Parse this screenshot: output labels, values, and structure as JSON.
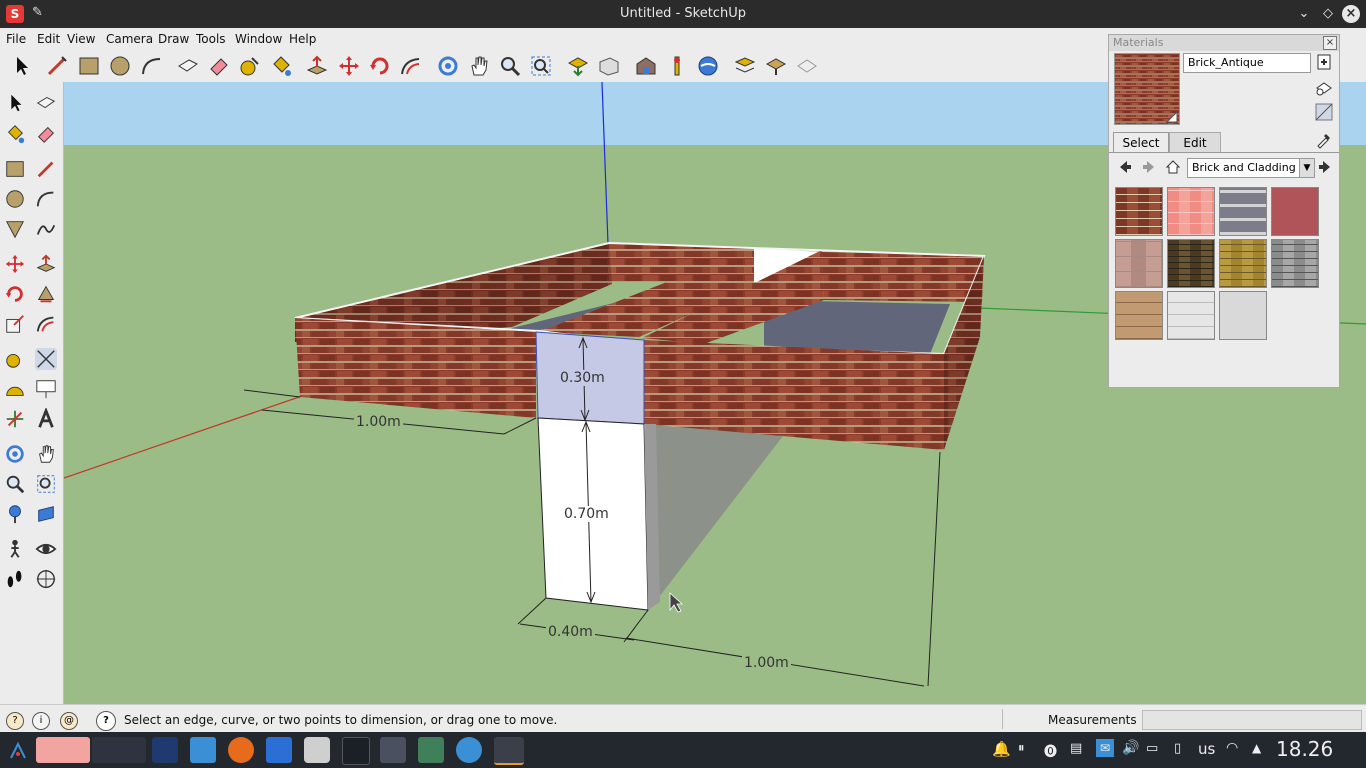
{
  "window": {
    "title": "Untitled - SketchUp"
  },
  "menu": [
    "File",
    "Edit",
    "View",
    "Camera",
    "Draw",
    "Tools",
    "Window",
    "Help"
  ],
  "materials_panel": {
    "title": "Materials",
    "material_name": "Brick_Antique",
    "tabs": [
      "Select",
      "Edit"
    ],
    "active_tab": "Select",
    "collection": "Brick and Cladding"
  },
  "dimensions": {
    "top_height": "0.30m",
    "left_width": "1.00m",
    "post_height": "0.70m",
    "post_width": "0.40m",
    "bottom_width": "1.00m"
  },
  "status": {
    "message": "Select an edge, curve, or two points to dimension, or drag one to move.",
    "measurements_label": "Measurements",
    "measurements_value": ""
  },
  "taskbar": {
    "keyboard_layout": "us",
    "clock": "18.26"
  },
  "colors": {
    "sky": "#a9d3ee",
    "ground": "#9bbc86",
    "brick": "#8a3b2a",
    "selection": "#c5c9e6",
    "accent_red": "#e53935"
  }
}
